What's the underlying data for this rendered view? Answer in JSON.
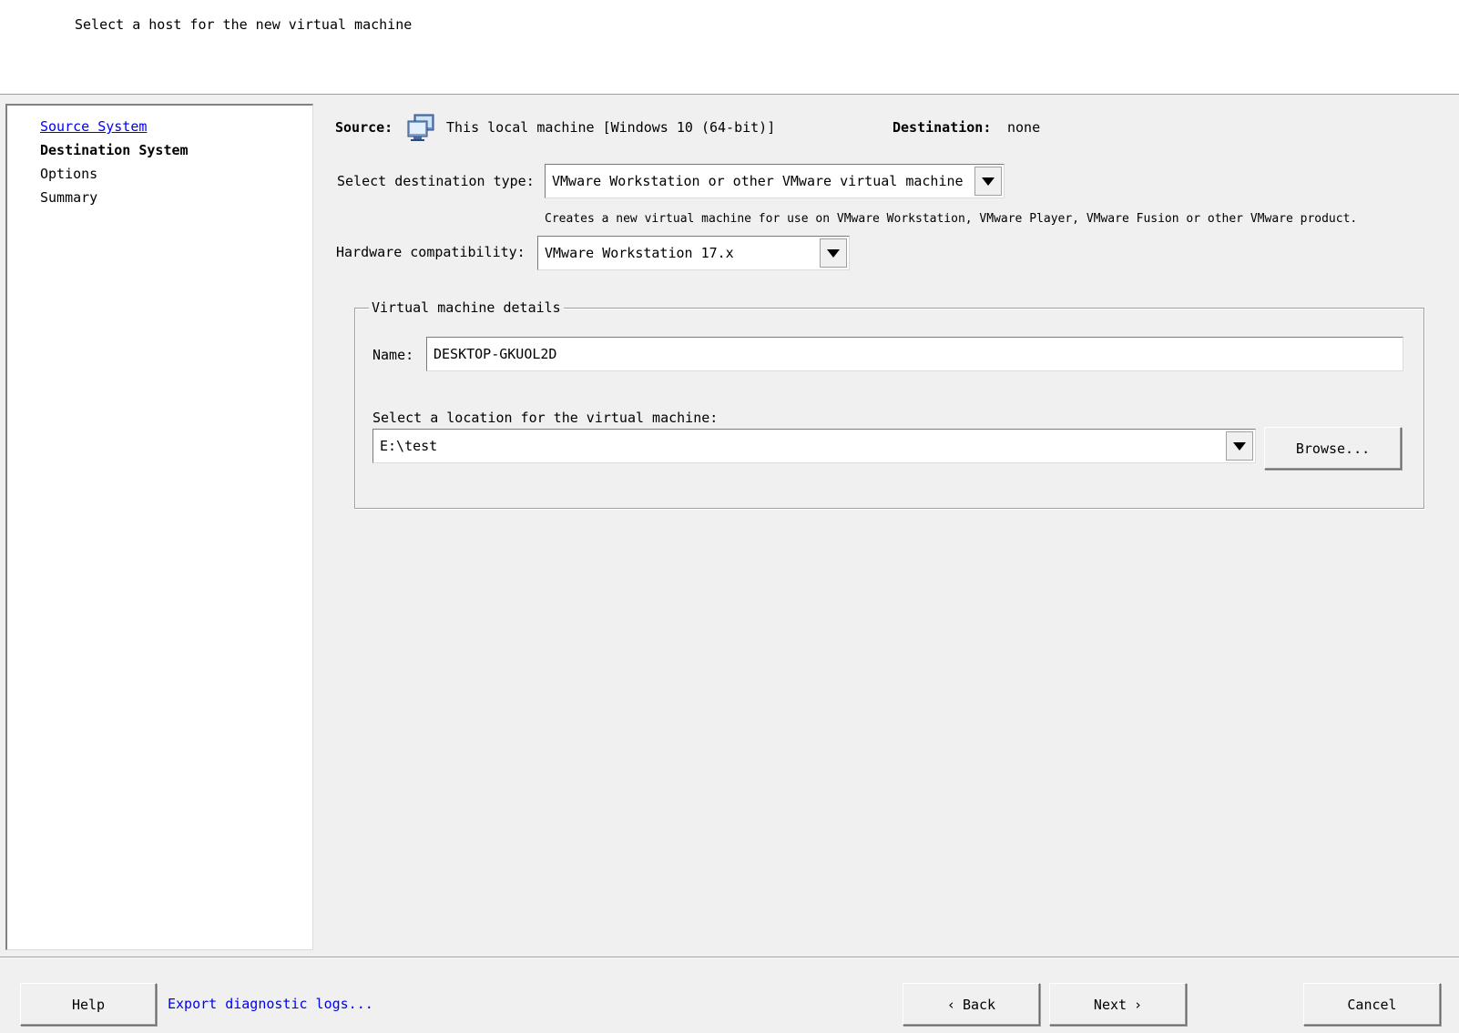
{
  "header": {
    "title": "Select a host for the new virtual machine"
  },
  "sidebar": {
    "items": [
      {
        "label": "Source System",
        "state": "link"
      },
      {
        "label": "Destination System",
        "state": "current"
      },
      {
        "label": "Options",
        "state": "pending"
      },
      {
        "label": "Summary",
        "state": "pending"
      }
    ]
  },
  "source": {
    "label": "Source:",
    "icon": "computer-icon",
    "value": "This local machine [Windows 10 (64-bit)]"
  },
  "destination": {
    "label": "Destination:",
    "value": "none"
  },
  "destination_type": {
    "label": "Select destination type:",
    "selected": "VMware Workstation or other VMware virtual machine",
    "description": "Creates a new virtual machine for use on VMware Workstation, VMware Player, VMware Fusion or other VMware product."
  },
  "hardware": {
    "label": "Hardware compatibility:",
    "selected": "VMware Workstation 17.x"
  },
  "vm_details": {
    "group_title": "Virtual machine details",
    "name_label": "Name:",
    "name_value": "DESKTOP-GKUOL2D",
    "location_label": "Select a location for the virtual machine:",
    "location_value": "E:\\test",
    "browse_label": "Browse..."
  },
  "footer": {
    "help_label": "Help",
    "export_logs_label": "Export diagnostic logs...",
    "back_label": "Back",
    "next_label": "Next",
    "cancel_label": "Cancel"
  },
  "colors": {
    "link": "#0000ee",
    "window_bg": "#f0f0f0",
    "panel_bg": "#ffffff"
  }
}
